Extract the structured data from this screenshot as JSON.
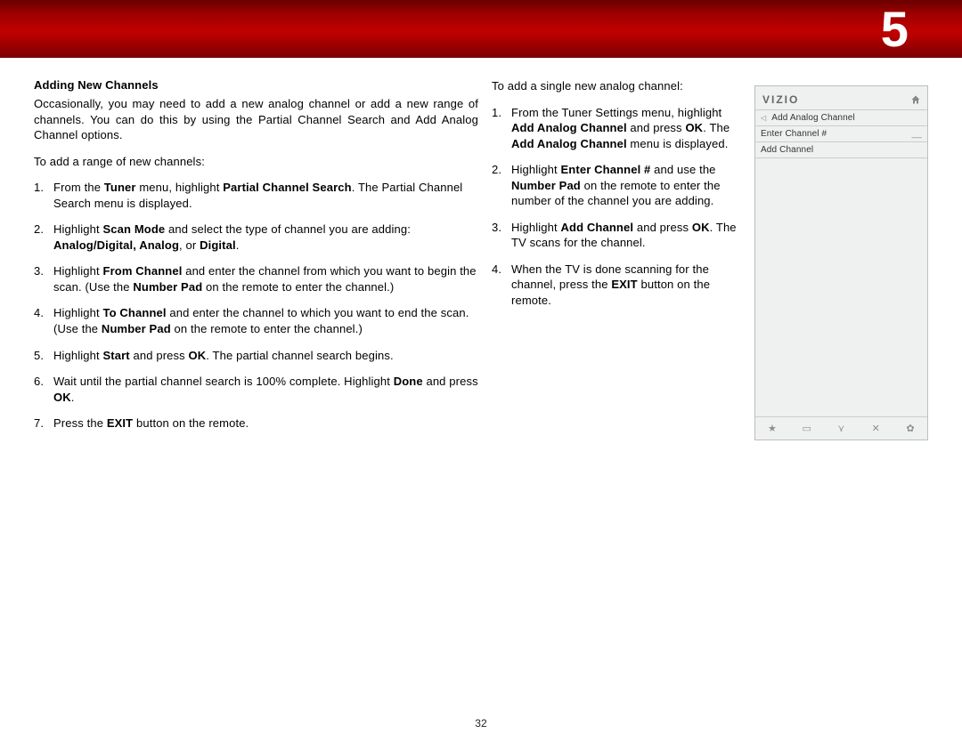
{
  "banner": {
    "chapter": "5"
  },
  "page_number": "32",
  "col1": {
    "heading": "Adding New Channels",
    "intro": "Occasionally, you may need to add a new analog channel or add a new range of channels. You can do this by using the Partial Channel Search and Add Analog Channel options.",
    "lead": "To add a range of new channels:",
    "steps": [
      {
        "pre": "From the ",
        "b1": "Tuner",
        "mid1": " menu, highlight ",
        "b2": "Partial Channel Search",
        "post": ". The Partial Channel Search menu is displayed."
      },
      {
        "pre": "Highlight ",
        "b1": "Scan Mode",
        "mid1": " and select the type of channel you are adding: ",
        "b2": "Analog/Digital, Analog",
        "mid2": ", or ",
        "b3": "Digital",
        "post": "."
      },
      {
        "pre": "Highlight ",
        "b1": "From Channel",
        "mid1": " and enter the channel from which you want to begin the scan. (Use the ",
        "b2": "Number Pad",
        "post": " on the remote to enter the channel.)"
      },
      {
        "pre": "Highlight ",
        "b1": "To Channel",
        "mid1": " and enter the channel to which you want to end the scan. (Use the ",
        "b2": "Number Pad",
        "post": " on the remote to enter the channel.)"
      },
      {
        "pre": "Highlight ",
        "b1": "Start",
        "mid1": " and press ",
        "b2": "OK",
        "post": ". The partial channel search begins."
      },
      {
        "pre": "Wait until the partial channel search is 100% complete. Highlight ",
        "b1": "Done",
        "mid1": " and press ",
        "b2": "OK",
        "post": "."
      },
      {
        "pre": "Press the ",
        "b1": "EXIT",
        "post": " button on the remote."
      }
    ]
  },
  "col2": {
    "lead": "To add a single new analog channel:",
    "steps": [
      {
        "pre": "From the Tuner Settings menu, highlight ",
        "b1": "Add Analog Channel",
        "mid1": " and press ",
        "b2": "OK",
        "mid2": ". The ",
        "b3": "Add Analog Channel",
        "post": " menu is displayed."
      },
      {
        "pre": "Highlight ",
        "b1": "Enter Channel #",
        "mid1": " and use the ",
        "b2": "Number Pad",
        "post": " on the remote to enter the number of the channel you are adding."
      },
      {
        "pre": "Highlight ",
        "b1": "Add Channel",
        "mid1": " and press ",
        "b2": "OK",
        "post": ". The TV scans for the channel."
      },
      {
        "pre": "When the TV is done scanning for the channel, press the ",
        "b1": "EXIT",
        "post": " button on the remote."
      }
    ]
  },
  "tv": {
    "logo": "VIZIO",
    "title": "Add Analog Channel",
    "rows": [
      {
        "label": "Enter Channel #",
        "value": "__"
      },
      {
        "label": "Add Channel",
        "value": ""
      }
    ],
    "footer_icons": [
      "★",
      "▭",
      "⋎",
      "✕",
      "✿"
    ]
  }
}
